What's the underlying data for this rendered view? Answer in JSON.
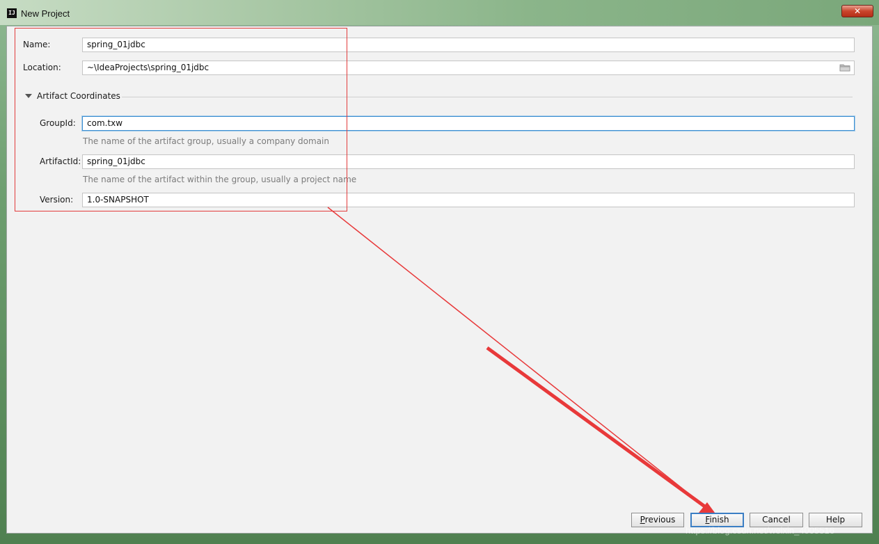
{
  "window": {
    "title": "New Project",
    "close_glyph": "✕",
    "icon_text": "IJ"
  },
  "form": {
    "name_label": "Name:",
    "name_value": "spring_01jdbc",
    "location_label": "Location:",
    "location_value": "~\\IdeaProjects\\spring_01jdbc",
    "section_title": "Artifact Coordinates",
    "groupid_label": "GroupId:",
    "groupid_value": "com.txw",
    "groupid_hint": "The name of the artifact group, usually a company domain",
    "artifactid_label": "ArtifactId:",
    "artifactid_value": "spring_01jdbc",
    "artifactid_hint": "The name of the artifact within the group, usually a project name",
    "version_label": "Version:",
    "version_value": "1.0-SNAPSHOT"
  },
  "buttons": {
    "previous_mn": "P",
    "previous_rest": "revious",
    "finish_mn": "F",
    "finish_rest": "inish",
    "cancel": "Cancel",
    "help": "Help"
  },
  "watermark": "https://blog.csdn.net/weixin_4005516",
  "icons": {
    "section_toggle": "triangle-down-icon",
    "browse": "folder-icon",
    "app": "intellij-icon"
  },
  "annotation": {
    "box_color": "#e23b3b",
    "arrow_color": "#e8393a"
  }
}
